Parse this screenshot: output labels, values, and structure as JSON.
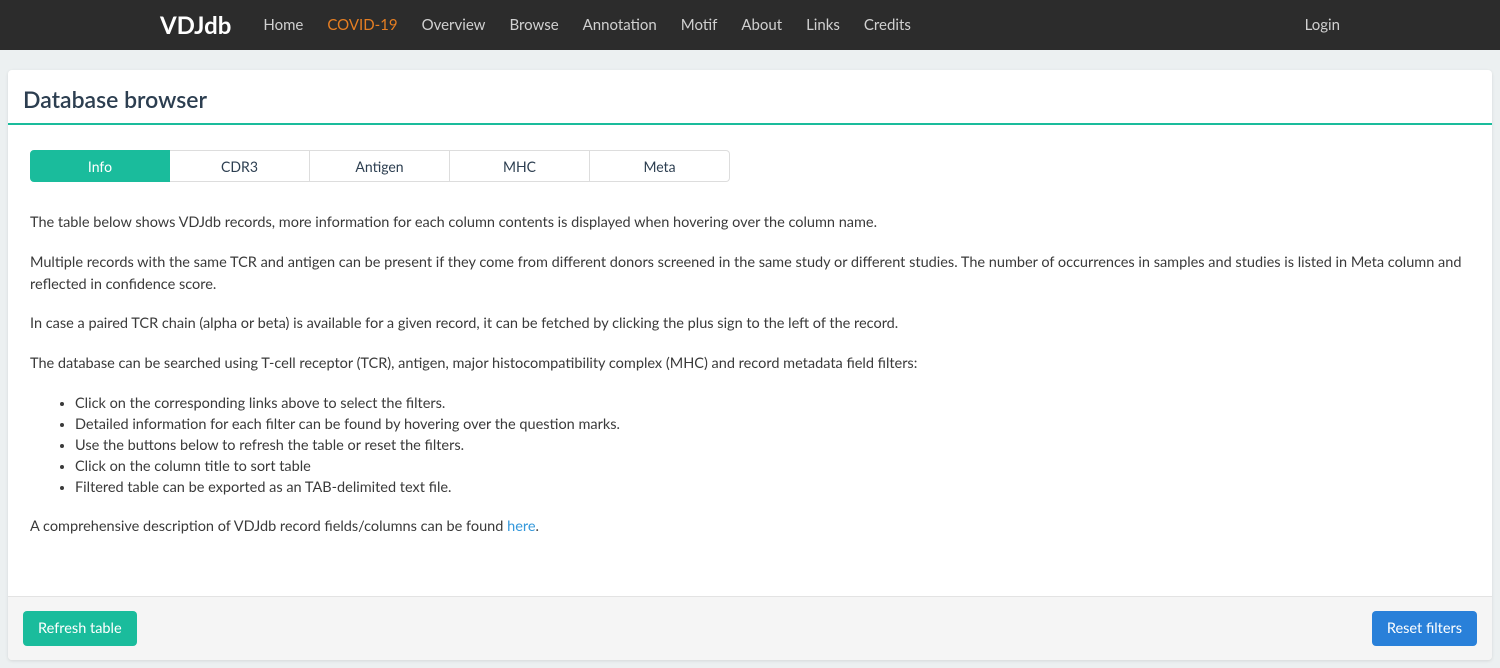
{
  "navbar": {
    "brand": "VDJdb",
    "items": [
      {
        "label": "Home",
        "highlight": false
      },
      {
        "label": "COVID-19",
        "highlight": true
      },
      {
        "label": "Overview",
        "highlight": false
      },
      {
        "label": "Browse",
        "highlight": false
      },
      {
        "label": "Annotation",
        "highlight": false
      },
      {
        "label": "Motif",
        "highlight": false
      },
      {
        "label": "About",
        "highlight": false
      },
      {
        "label": "Links",
        "highlight": false
      },
      {
        "label": "Credits",
        "highlight": false
      }
    ],
    "login": "Login"
  },
  "page": {
    "title": "Database browser"
  },
  "tabs": [
    {
      "label": "Info",
      "active": true
    },
    {
      "label": "CDR3",
      "active": false
    },
    {
      "label": "Antigen",
      "active": false
    },
    {
      "label": "MHC",
      "active": false
    },
    {
      "label": "Meta",
      "active": false
    }
  ],
  "info": {
    "p1": "The table below shows VDJdb records, more information for each column contents is displayed when hovering over the column name.",
    "p2": "Multiple records with the same TCR and antigen can be present if they come from different donors screened in the same study or different studies. The number of occurrences in samples and studies is listed in Meta column and reflected in confidence score.",
    "p3": "In case a paired TCR chain (alpha or beta) is available for a given record, it can be fetched by clicking the plus sign to the left of the record.",
    "p4": "The database can be searched using T-cell receptor (TCR), antigen, major histocompatibility complex (MHC) and record metadata field filters:",
    "bullets": [
      "Click on the corresponding links above to select the filters.",
      "Detailed information for each filter can be found by hovering over the question marks.",
      "Use the buttons below to refresh the table or reset the filters.",
      "Click on the column title to sort table",
      "Filtered table can be exported as an TAB-delimited text file."
    ],
    "p5_prefix": "A comprehensive description of VDJdb record fields/columns can be found ",
    "p5_link": "here",
    "p5_suffix": "."
  },
  "footer": {
    "refresh": "Refresh table",
    "reset": "Reset filters"
  }
}
